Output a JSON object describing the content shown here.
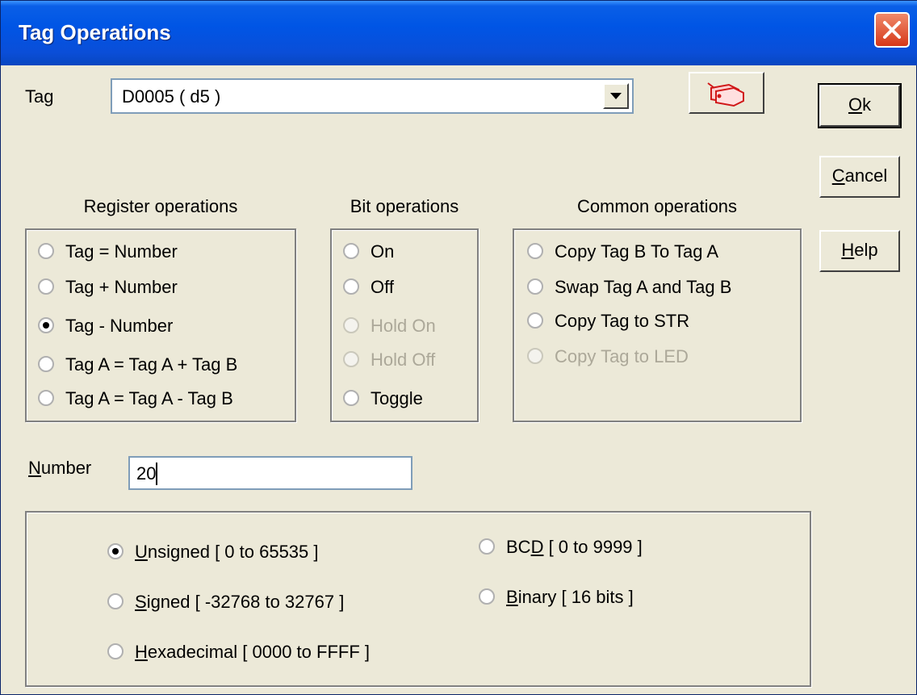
{
  "window": {
    "title": "Tag Operations"
  },
  "tag": {
    "label": "Tag",
    "value": "D0005 ( d5 )"
  },
  "buttons": {
    "ok": {
      "pre": "",
      "mn": "O",
      "post": "k"
    },
    "cancel": {
      "pre": "",
      "mn": "C",
      "post": "ancel"
    },
    "help": {
      "pre": "",
      "mn": "H",
      "post": "elp"
    }
  },
  "register_group": {
    "title": "Register operations",
    "options": [
      {
        "label": "Tag  =  Number",
        "checked": false,
        "disabled": false
      },
      {
        "label": "Tag  +  Number",
        "checked": false,
        "disabled": false
      },
      {
        "label": "Tag  -  Number",
        "checked": true,
        "disabled": false
      },
      {
        "label": "Tag A = Tag A + Tag B",
        "checked": false,
        "disabled": false
      },
      {
        "label": "Tag A = Tag A - Tag B",
        "checked": false,
        "disabled": false
      }
    ]
  },
  "bit_group": {
    "title": "Bit operations",
    "options": [
      {
        "label": "On",
        "checked": false,
        "disabled": false
      },
      {
        "label": "Off",
        "checked": false,
        "disabled": false
      },
      {
        "label": "Hold On",
        "checked": false,
        "disabled": true
      },
      {
        "label": "Hold Off",
        "checked": false,
        "disabled": true
      },
      {
        "label": "Toggle",
        "checked": false,
        "disabled": false
      }
    ]
  },
  "common_group": {
    "title": "Common operations",
    "options": [
      {
        "label": "Copy Tag B To Tag A",
        "checked": false,
        "disabled": false
      },
      {
        "label": "Swap Tag A and Tag B",
        "checked": false,
        "disabled": false
      },
      {
        "label": "Copy Tag to STR",
        "checked": false,
        "disabled": false
      },
      {
        "label": "Copy Tag to LED",
        "checked": false,
        "disabled": true
      }
    ]
  },
  "number": {
    "label_mn": "N",
    "label_rest": "umber",
    "value": "20"
  },
  "format_group": {
    "unsigned": {
      "mn": "U",
      "rest": "nsigned [ 0 to 65535 ]",
      "checked": true
    },
    "signed": {
      "mn": "S",
      "rest": "igned [ -32768 to 32767 ]",
      "checked": false
    },
    "hex": {
      "mn": "H",
      "rest": "exadecimal [ 0000 to FFFF ]",
      "checked": false
    },
    "bcd": {
      "pre": "BC",
      "mn": "D",
      "rest": " [ 0 to 9999 ]",
      "checked": false
    },
    "binary": {
      "mn": "B",
      "rest": "inary [ 16 bits ]",
      "checked": false
    }
  },
  "colors": {
    "title_bar": "#0055e5",
    "dialog_bg": "#ece9d8",
    "disabled_text": "#aca899"
  },
  "icons": {
    "close": "close-x-icon",
    "tag_browse": "tag-browse-icon",
    "dropdown": "chevron-down-icon"
  }
}
